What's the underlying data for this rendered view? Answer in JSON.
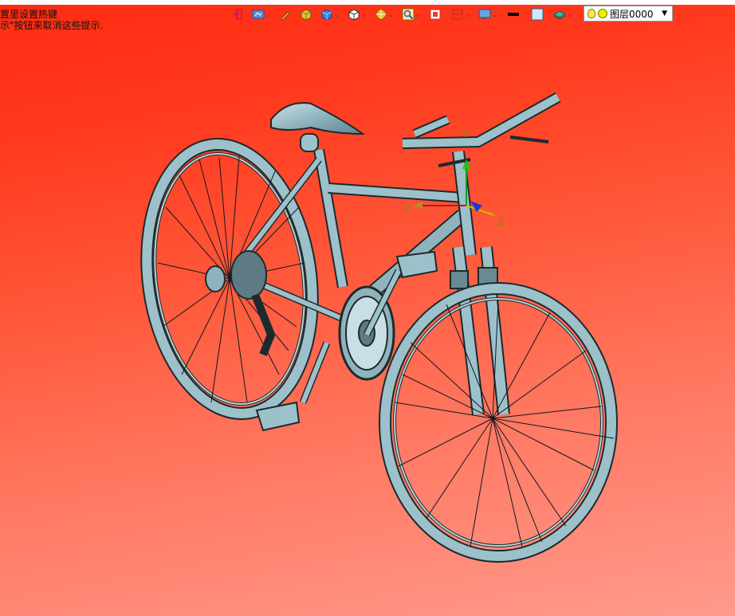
{
  "hint": {
    "line1": "置里设置热键",
    "line2": "示\"按钮来取消这些提示."
  },
  "toolbar": {
    "tools": [
      {
        "name": "exit-tool",
        "icon": "exit-icon",
        "has_menu": false
      },
      {
        "name": "view-tool",
        "icon": "view-icon",
        "has_menu": true
      },
      {
        "name": "pen-tool",
        "icon": "pen-icon",
        "has_menu": false
      },
      {
        "name": "shade-tool",
        "icon": "shaded-box-icon",
        "has_menu": false
      },
      {
        "name": "solid-tool",
        "icon": "solid-box-icon",
        "has_menu": true
      },
      {
        "name": "wire-tool",
        "icon": "wire-box-icon",
        "has_menu": true
      },
      {
        "name": "section-tool",
        "icon": "section-icon",
        "has_menu": true
      },
      {
        "name": "zoom-tool",
        "icon": "zoom-icon",
        "has_menu": true
      },
      {
        "name": "fit-tool",
        "icon": "fit-icon",
        "has_menu": false
      },
      {
        "name": "split-tool",
        "icon": "split-icon",
        "has_menu": true
      },
      {
        "name": "display-tool",
        "icon": "display-icon",
        "has_menu": true
      },
      {
        "name": "line-color-tool",
        "icon": "line-color-icon",
        "has_menu": false
      },
      {
        "name": "fill-color-tool",
        "icon": "fill-color-icon",
        "has_menu": false
      },
      {
        "name": "layer-tool",
        "icon": "layers-icon",
        "has_menu": true
      }
    ]
  },
  "layer": {
    "value": "图层0000"
  },
  "axes": {
    "x": "X",
    "y": "Y",
    "z": "Z"
  },
  "colors": {
    "bike_fill": "#8fb3bd",
    "bike_stroke": "#1c2a2e",
    "background_top": "#ff2b12",
    "background_bottom": "#ff9a8c"
  }
}
